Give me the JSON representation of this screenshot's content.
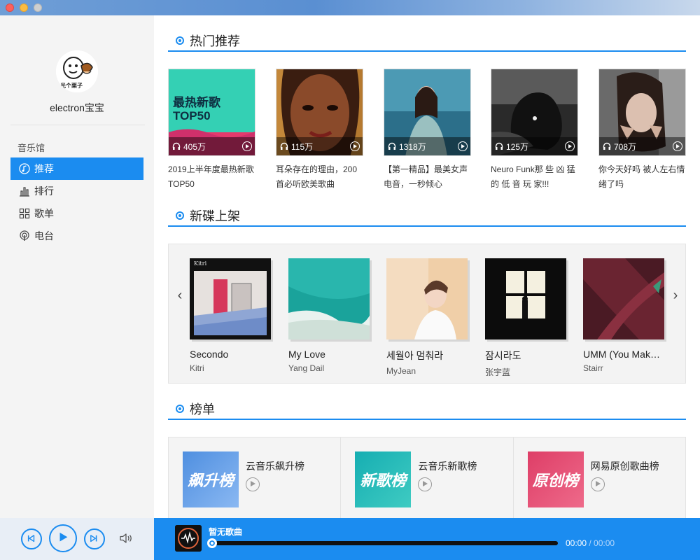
{
  "window": {
    "buttons": [
      "close",
      "minimize",
      "zoom"
    ]
  },
  "sidebar": {
    "username": "electron宝宝",
    "avatar_text": "光个栗子",
    "section": "音乐馆",
    "items": [
      {
        "label": "推荐",
        "icon": "music-note-icon",
        "active": true
      },
      {
        "label": "排行",
        "icon": "bar-chart-icon",
        "active": false
      },
      {
        "label": "歌单",
        "icon": "grid-icon",
        "active": false
      },
      {
        "label": "电台",
        "icon": "radio-icon",
        "active": false
      }
    ]
  },
  "sections": {
    "hot": "热门推荐",
    "new_albums": "新碟上架",
    "charts": "榜单"
  },
  "hot_playlists": [
    {
      "plays": "405万",
      "title": "2019上半年度最热新歌TOP50",
      "cover_text": "最热新歌TOP50"
    },
    {
      "plays": "115万",
      "title": "耳朵存在的理由，200首必听欧美歌曲"
    },
    {
      "plays": "1318万",
      "title": "【第一精品】最美女声电音，一秒倾心"
    },
    {
      "plays": "125万",
      "title": "Neuro Funk那 些 凶 猛 的 低 音 玩 家!!!"
    },
    {
      "plays": "708万",
      "title": "你今天好吗 被人左右情绪了吗"
    }
  ],
  "albums": [
    {
      "title": "Secondo",
      "artist": "Kitri",
      "cover_text": "Kitri"
    },
    {
      "title": "My Love",
      "artist": "Yang Dail"
    },
    {
      "title": "세월아 멈춰라",
      "artist": "MyJean"
    },
    {
      "title": "잠시라도",
      "artist": "张宇蓝"
    },
    {
      "title": "UMM (You Mak…",
      "artist": "Stairr"
    }
  ],
  "carousel": {
    "prev": "‹",
    "next": "›"
  },
  "charts": [
    {
      "name": "云音乐飙升榜",
      "cover_text": "飙升榜",
      "color_a": "#5b9be6",
      "color_b": "#7aaef0"
    },
    {
      "name": "云音乐新歌榜",
      "cover_text": "新歌榜",
      "color_a": "#1fb5b8",
      "color_b": "#2fc3c0"
    },
    {
      "name": "网易原创歌曲榜",
      "cover_text": "原创榜",
      "color_a": "#e24b70",
      "color_b": "#ea5d80"
    }
  ],
  "player": {
    "now_playing": "暂无歌曲",
    "current_time": "00:00",
    "total_time": "/ 00:00",
    "progress": 0,
    "accent": "#1b8cf0"
  }
}
